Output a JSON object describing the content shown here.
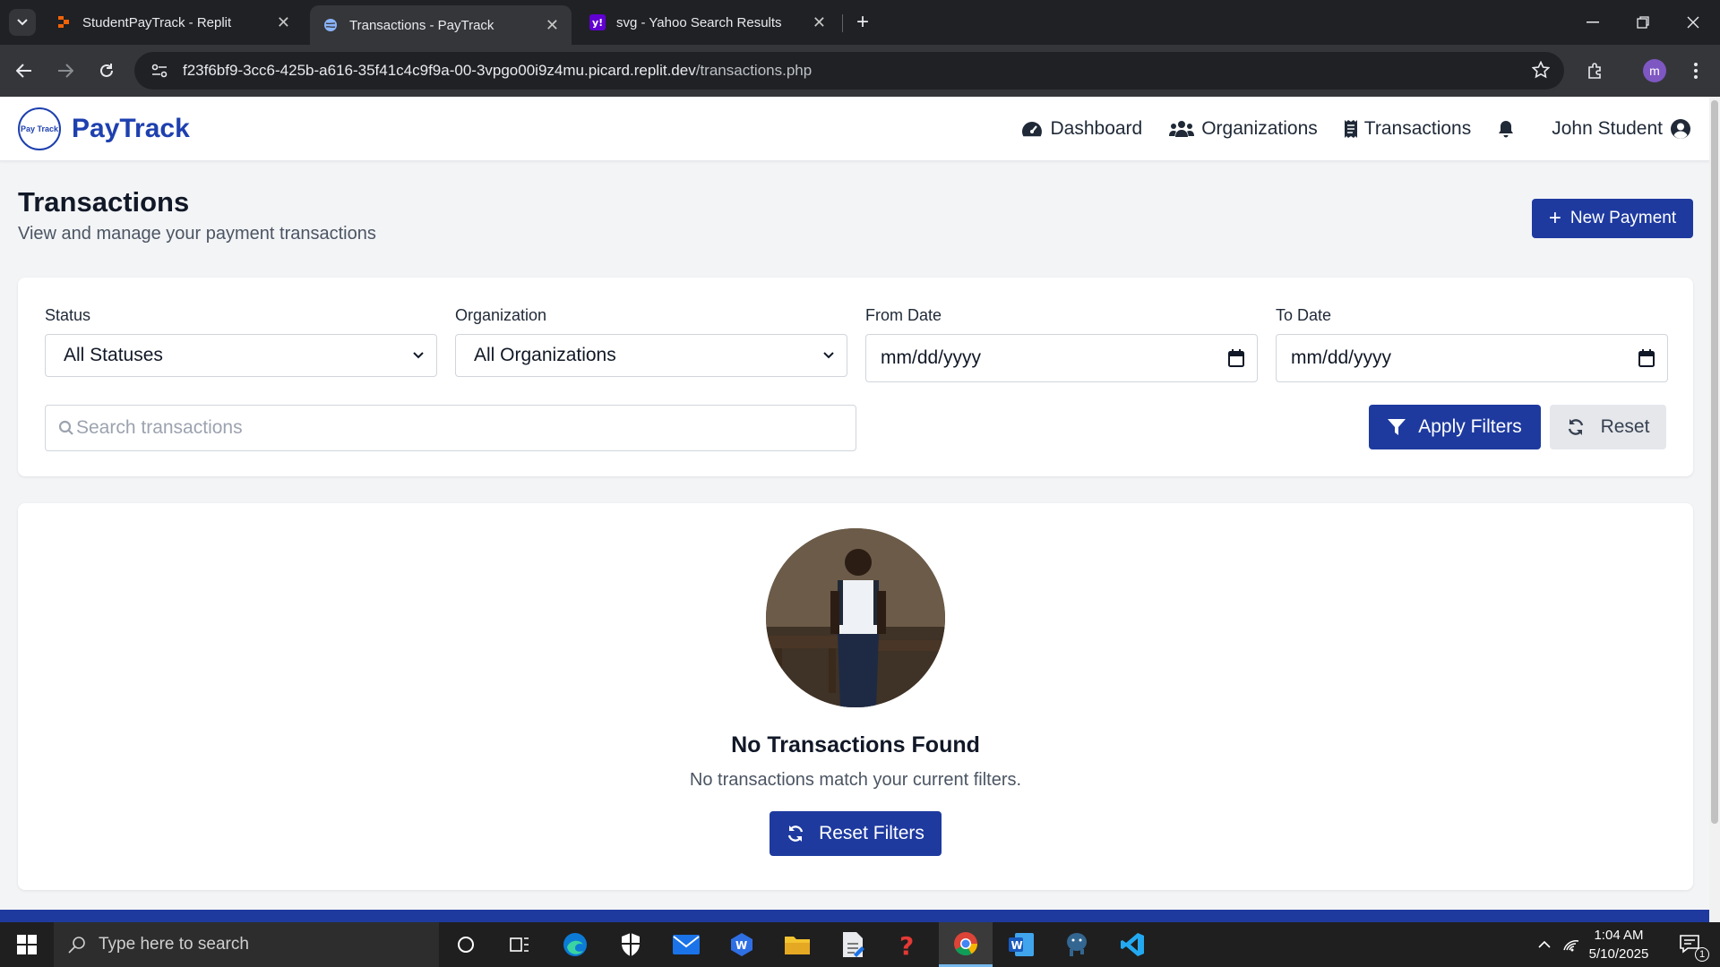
{
  "browser": {
    "tabs": [
      {
        "title": "StudentPayTrack - Replit",
        "active": false
      },
      {
        "title": "Transactions - PayTrack",
        "active": true
      },
      {
        "title": "svg - Yahoo Search Results",
        "active": false
      }
    ],
    "url_host": "f23f6bf9-3cc6-425b-a616-35f41c4c9f9a-00-3vpgo00i9z4mu.picard.replit.dev",
    "url_path": "/transactions.php",
    "profile_initial": "m"
  },
  "app": {
    "logo_text": "Pay Track",
    "brand": "PayTrack",
    "nav": {
      "dashboard": "Dashboard",
      "organizations": "Organizations",
      "transactions": "Transactions",
      "user": "John Student"
    },
    "colors": {
      "primary": "#1e3a9f",
      "brand": "#1e40af"
    }
  },
  "page": {
    "title": "Transactions",
    "subtitle": "View and manage your payment transactions",
    "new_payment": "New Payment"
  },
  "filters": {
    "status_label": "Status",
    "status_value": "All Statuses",
    "org_label": "Organization",
    "org_value": "All Organizations",
    "from_label": "From Date",
    "from_value": "mm/dd/yyyy",
    "to_label": "To Date",
    "to_value": "mm/dd/yyyy",
    "search_placeholder": "Search transactions",
    "apply": "Apply Filters",
    "reset": "Reset"
  },
  "empty": {
    "title": "No Transactions Found",
    "text": "No transactions match your current filters.",
    "button": "Reset Filters"
  },
  "taskbar": {
    "search_placeholder": "Type here to search",
    "time": "1:04 AM",
    "date": "5/10/2025",
    "notification_count": "1"
  }
}
